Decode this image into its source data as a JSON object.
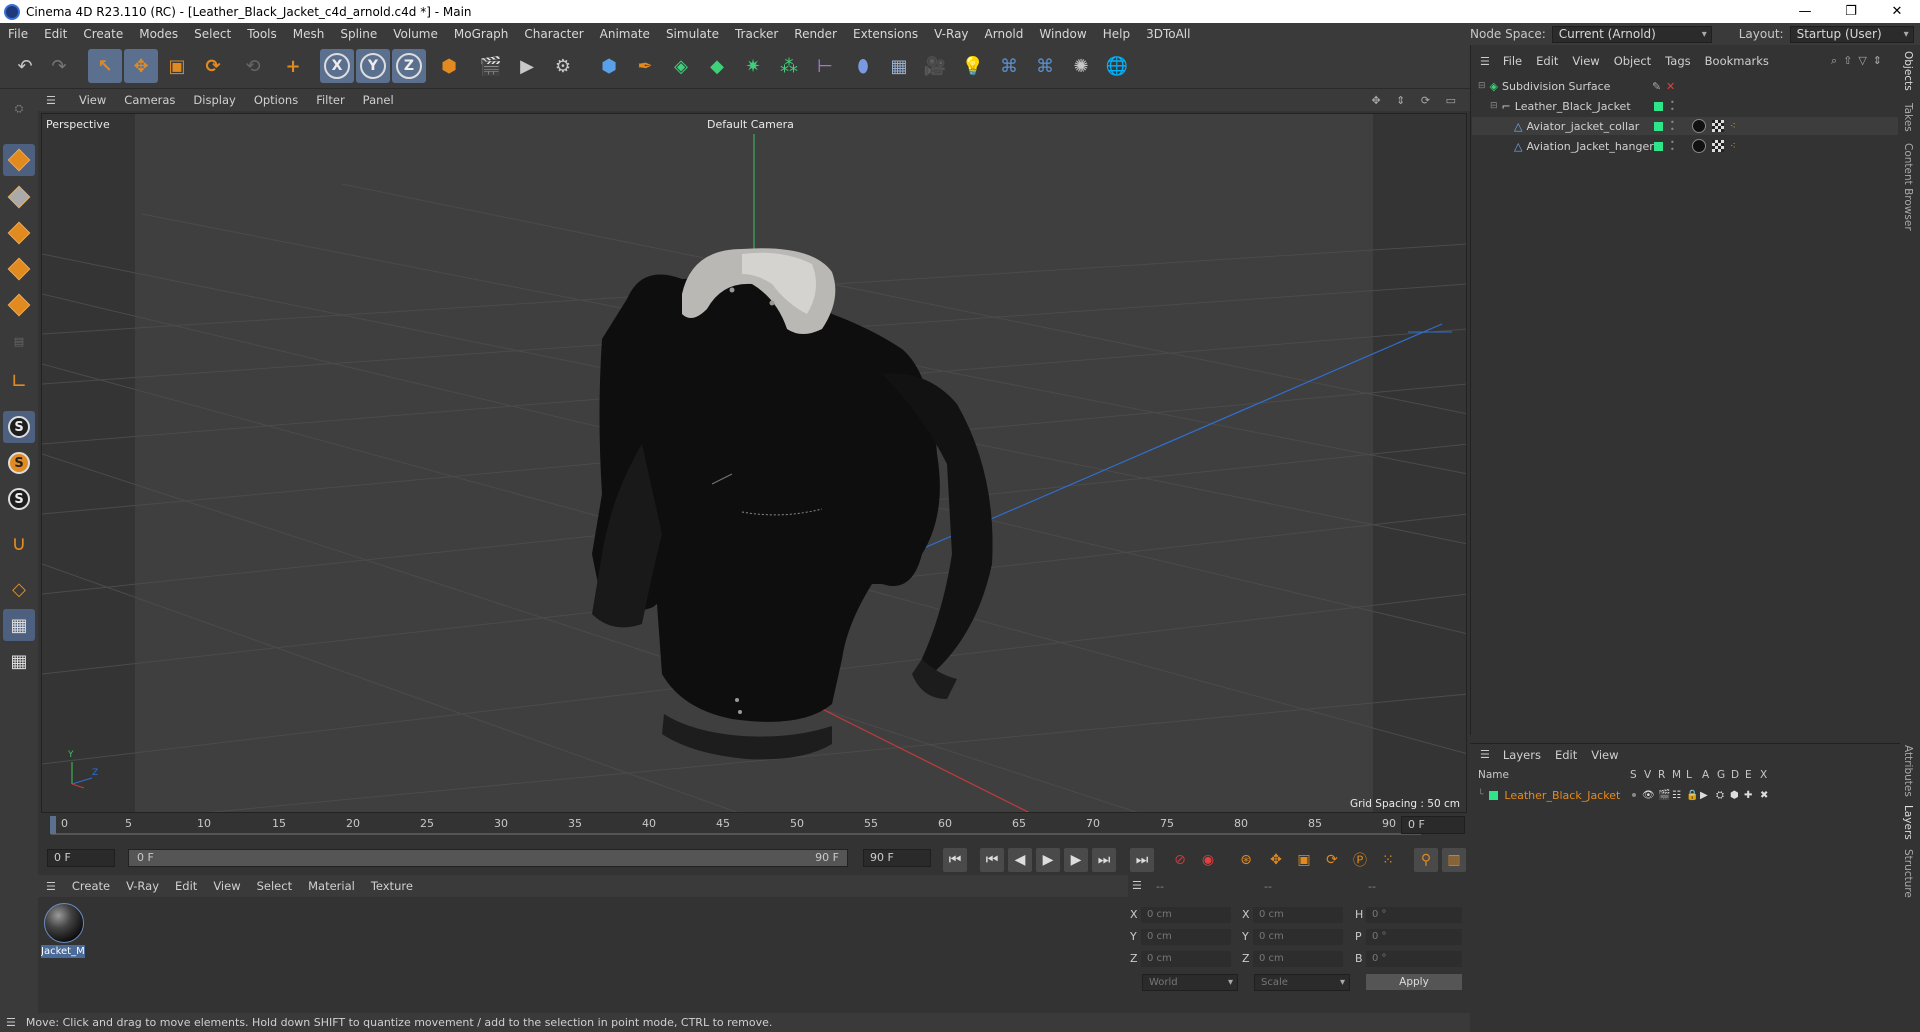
{
  "window": {
    "title": "Cinema 4D R23.110 (RC) - [Leather_Black_Jacket_c4d_arnold.c4d *] - Main",
    "controls": [
      "—",
      "❐",
      "✕"
    ]
  },
  "menu": [
    "File",
    "Edit",
    "Create",
    "Modes",
    "Select",
    "Tools",
    "Mesh",
    "Spline",
    "Volume",
    "MoGraph",
    "Character",
    "Animate",
    "Simulate",
    "Tracker",
    "Render",
    "Extensions",
    "V-Ray",
    "Arnold",
    "Window",
    "Help",
    "3DToAll"
  ],
  "node_space": {
    "label": "Node Space:",
    "value": "Current (Arnold)"
  },
  "layout": {
    "label": "Layout:",
    "value": "Startup (User)"
  },
  "toolbar": {
    "axis_x": "X",
    "axis_y": "Y",
    "axis_z": "Z"
  },
  "viewport": {
    "menu": [
      "View",
      "Cameras",
      "Display",
      "Options",
      "Filter",
      "Panel"
    ],
    "view_name": "Perspective",
    "camera": "Default Camera",
    "grid_spacing": "Grid Spacing : 50 cm",
    "axis_y": "Y",
    "axis_z": "Z",
    "colors": {
      "grid": "#4a4a4a",
      "x_axis": "#c83a3a",
      "y_axis": "#3bc45c",
      "z_axis": "#2f6fd0"
    }
  },
  "timeline": {
    "ticks": [
      "0",
      "5",
      "10",
      "15",
      "20",
      "25",
      "30",
      "35",
      "40",
      "45",
      "50",
      "55",
      "60",
      "65",
      "70",
      "75",
      "80",
      "85",
      "90"
    ],
    "current_frame": "0 F",
    "start_field": "0 F",
    "range_start": "0 F",
    "range_end": "90 F",
    "end_field": "90 F",
    "right_frame": "0 F"
  },
  "material_manager": {
    "menu": [
      "Create",
      "V-Ray",
      "Edit",
      "View",
      "Select",
      "Material",
      "Texture"
    ],
    "material_name": "Jacket_M"
  },
  "coordinates": {
    "headers": [
      "--",
      "--",
      "--"
    ],
    "rows": [
      {
        "a_lbl": "X",
        "a_val": "0 cm",
        "b_lbl": "X",
        "b_val": "0 cm",
        "c_lbl": "H",
        "c_val": "0 °"
      },
      {
        "a_lbl": "Y",
        "a_val": "0 cm",
        "b_lbl": "Y",
        "b_val": "0 cm",
        "c_lbl": "P",
        "c_val": "0 °"
      },
      {
        "a_lbl": "Z",
        "a_val": "0 cm",
        "b_lbl": "Z",
        "b_val": "0 cm",
        "c_lbl": "B",
        "c_val": "0 °"
      }
    ],
    "mode": "World",
    "transform": "Scale",
    "apply": "Apply"
  },
  "status": "Move: Click and drag to move elements. Hold down SHIFT to quantize movement / add to the selection in point mode, CTRL to remove.",
  "object_manager": {
    "menu": [
      "File",
      "Edit",
      "View",
      "Object",
      "Tags",
      "Bookmarks"
    ],
    "objects": [
      {
        "name": "Subdivision Surface",
        "indent": 0
      },
      {
        "name": "Leather_Black_Jacket",
        "indent": 1
      },
      {
        "name": "Aviator_jacket_collar",
        "indent": 2
      },
      {
        "name": "Aviation_Jacket_hanger",
        "indent": 2
      }
    ]
  },
  "layers": {
    "menu": [
      "Layers",
      "Edit",
      "View"
    ],
    "col_name": "Name",
    "flags": [
      "S",
      "V",
      "R",
      "M",
      "L",
      "A",
      "G",
      "D",
      "E",
      "X"
    ],
    "items": [
      {
        "name": "Leather_Black_Jacket",
        "color": "#e8891d"
      }
    ]
  },
  "vertical_tabs": [
    "Objects",
    "Takes",
    "Content Browser",
    "Attributes",
    "Layers",
    "Structure"
  ]
}
